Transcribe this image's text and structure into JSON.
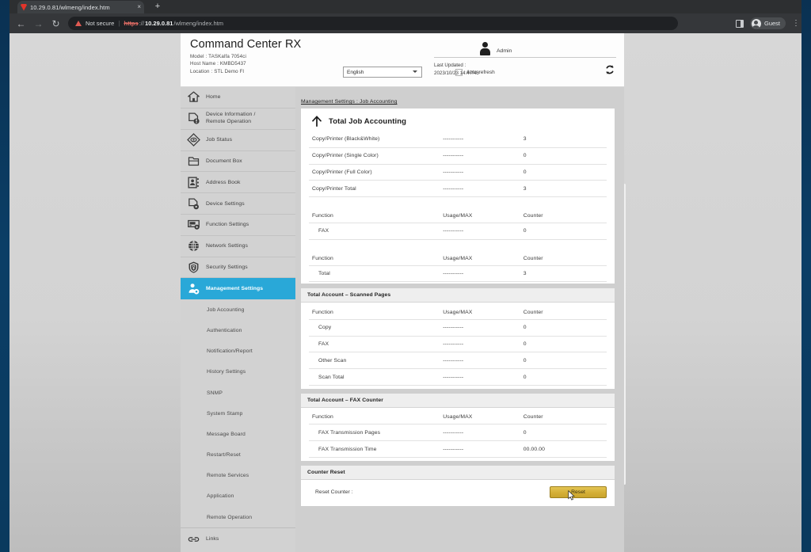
{
  "browser": {
    "tab_title": "10.29.0.81/wlmeng/index.htm",
    "tab_close": "×",
    "new_tab": "+",
    "back_icon": "←",
    "forward_icon": "→",
    "reload_icon": "↻",
    "security_label": "Not secure",
    "url_scheme": "https",
    "url_sep": "://",
    "url_host": "10.29.0.81",
    "url_path": "/wlmeng/index.htm",
    "profile_label": "Guest",
    "kebab_glyph": "⋮"
  },
  "header": {
    "app_title": "Command Center RX",
    "model": "Model : TASKalfa 7054ci",
    "host_name": "Host Name : KMBD5437",
    "location": "Location : STL Demo Fl",
    "language_value": "English",
    "auto_refresh_label": "Auto-refresh",
    "admin_label": "Admin",
    "last_updated_label": "Last Updated :",
    "last_updated_value": "2023/10/23 14:47:43"
  },
  "sidebar": {
    "items": [
      {
        "label": "Home",
        "icon": "home-icon"
      },
      {
        "label_line1": "Device Information /",
        "label_line2": "Remote Operation",
        "icon": "device-info-icon"
      },
      {
        "label": "Job Status",
        "icon": "job-status-icon"
      },
      {
        "label": "Document Box",
        "icon": "document-box-icon"
      },
      {
        "label": "Address Book",
        "icon": "address-book-icon"
      },
      {
        "label": "Device Settings",
        "icon": "device-settings-icon"
      },
      {
        "label": "Function Settings",
        "icon": "function-settings-icon"
      },
      {
        "label": "Network Settings",
        "icon": "network-settings-icon"
      },
      {
        "label": "Security Settings",
        "icon": "security-settings-icon"
      },
      {
        "label": "Management Settings",
        "icon": "management-settings-icon",
        "active": true
      }
    ],
    "sub_items": [
      "Job Accounting",
      "Authentication",
      "Notification/Report",
      "History Settings",
      "SNMP",
      "System Stamp",
      "Message Board",
      "Restart/Reset",
      "Remote Services",
      "Application",
      "Remote Operation"
    ],
    "links_label": "Links",
    "active_color": "#29a8d8"
  },
  "main": {
    "breadcrumb": "Management Settings : Job Accounting",
    "section_title": "Total Job Accounting",
    "total_job_rows": [
      {
        "function": "Copy/Printer (Black&White)",
        "usage": "-----------",
        "counter": "3"
      },
      {
        "function": "Copy/Printer (Single Color)",
        "usage": "-----------",
        "counter": "0"
      },
      {
        "function": "Copy/Printer (Full Color)",
        "usage": "-----------",
        "counter": "0"
      },
      {
        "function": "Copy/Printer Total",
        "usage": "-----------",
        "counter": "3"
      }
    ],
    "columns": {
      "function": "Function",
      "usage": "Usage/MAX",
      "counter": "Counter"
    },
    "fax_rows": [
      {
        "function": "FAX",
        "usage": "-----------",
        "counter": "0"
      }
    ],
    "total_rows": [
      {
        "function": "Total",
        "usage": "-----------",
        "counter": "3"
      }
    ],
    "scanned_pages": {
      "title": "Total Account – Scanned Pages",
      "rows": [
        {
          "function": "Copy",
          "usage": "-----------",
          "counter": "0"
        },
        {
          "function": "FAX",
          "usage": "-----------",
          "counter": "0"
        },
        {
          "function": "Other Scan",
          "usage": "-----------",
          "counter": "0"
        },
        {
          "function": "Scan Total",
          "usage": "-----------",
          "counter": "0"
        }
      ]
    },
    "fax_counter": {
      "title": "Total Account – FAX Counter",
      "rows": [
        {
          "function": "FAX Transmission Pages",
          "usage": "-----------",
          "counter": "0"
        },
        {
          "function": "FAX Transmission Time",
          "usage": "-----------",
          "counter": "00.00.00"
        }
      ]
    },
    "counter_reset": {
      "title": "Counter Reset",
      "label": "Reset Counter :",
      "button_label": "Reset",
      "button_color": "#d4af36"
    }
  }
}
